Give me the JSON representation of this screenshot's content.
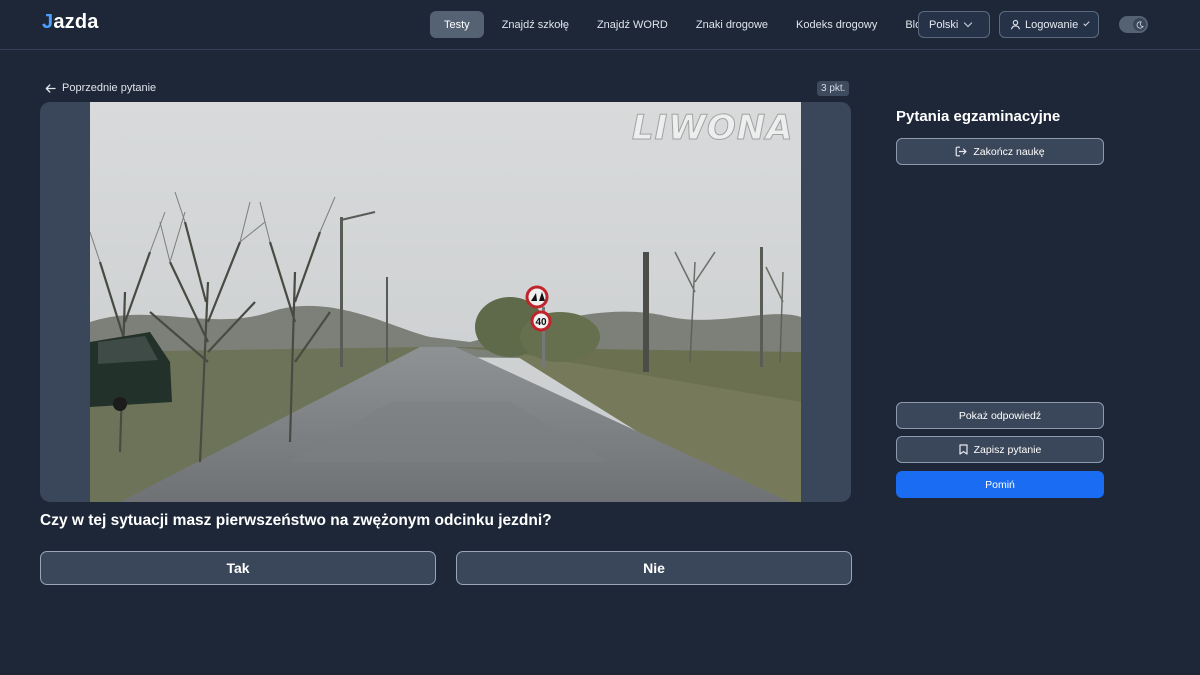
{
  "header": {
    "logo_prefix": "J",
    "logo_rest": "azda",
    "nav": [
      "Testy",
      "Znajdź szkołę",
      "Znajdź WORD",
      "Znaki drogowe",
      "Kodeks drogowy",
      "Blog"
    ],
    "language": "Polski",
    "login": "Logowanie"
  },
  "main": {
    "prev_label": "Poprzednie pytanie",
    "points": "3 pkt.",
    "watermark": "LIWONA",
    "sign_number": "40",
    "question": "Czy w tej sytuacji masz pierwszeństwo na zwężonym odcinku jezdni?",
    "answers": [
      "Tak",
      "Nie"
    ]
  },
  "sidebar": {
    "title": "Pytania egzaminacyjne",
    "finish": "Zakończ naukę",
    "show_answer": "Pokaż odpowiedź",
    "save": "Zapisz pytanie",
    "skip": "Pomiń"
  },
  "colors": {
    "background": "#1e2738",
    "primary": "#1a6cf2",
    "surface": "#3a4659"
  }
}
